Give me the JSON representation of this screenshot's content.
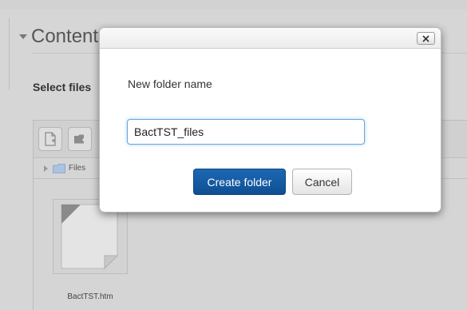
{
  "background": {
    "section_title": "Content",
    "select_files_label": "Select files",
    "filemanager": {
      "path_label": "Files",
      "file": {
        "name": "BactTST.htm"
      }
    }
  },
  "dialog": {
    "close_label": "×",
    "field_label": "New folder name",
    "folder_name_value": "BactTST_files",
    "create_button_label": "Create folder",
    "cancel_button_label": "Cancel"
  },
  "colors": {
    "primary_button": "#1a5fa8",
    "input_focus": "#6aa6dc",
    "overlay_background": "#d6d6d6"
  },
  "icons": {
    "add_file": "add-file-icon",
    "create_folder": "create-folder-icon",
    "folder": "folder-icon",
    "file_document": "file-document-icon",
    "close": "close-icon",
    "collapse_arrow": "collapse-arrow-icon"
  }
}
